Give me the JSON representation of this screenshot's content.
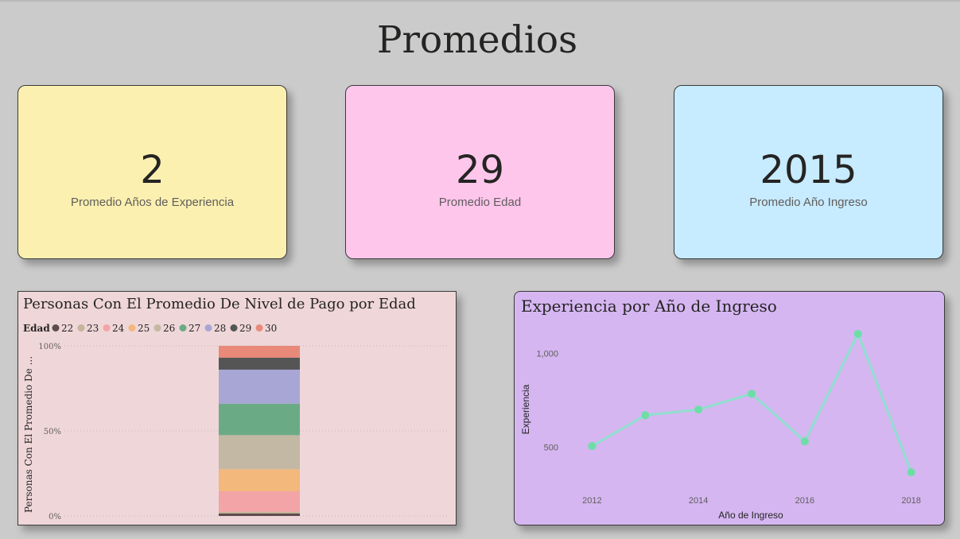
{
  "page": {
    "title": "Promedios"
  },
  "cards": [
    {
      "value": "2",
      "label": "Promedio Años de Experiencia",
      "bg": "#fbf0b0"
    },
    {
      "value": "29",
      "label": "Promedio Edad",
      "bg": "#ffc6ec"
    },
    {
      "value": "2015",
      "label": "Promedio Año Ingreso",
      "bg": "#c7ebff"
    }
  ],
  "chart_data": [
    {
      "type": "bar",
      "stacked": "100%",
      "title": "Personas Con El Promedio De Nivel de Pago por Edad",
      "ylabel": "Personas Con El Promedio De ...",
      "legend": {
        "title": "Edad",
        "placement": "top-left",
        "items": [
          {
            "name": "22",
            "color": "#5e4b4b"
          },
          {
            "name": "23",
            "color": "#c7b39a"
          },
          {
            "name": "24",
            "color": "#f3a4a6"
          },
          {
            "name": "25",
            "color": "#f2b87c"
          },
          {
            "name": "26",
            "color": "#c2b8a4"
          },
          {
            "name": "27",
            "color": "#6aab86"
          },
          {
            "name": "28",
            "color": "#a8a6d4"
          },
          {
            "name": "29",
            "color": "#555555"
          },
          {
            "name": "30",
            "color": "#e8897a"
          }
        ]
      },
      "yticks": [
        "100%",
        "50%",
        "0%"
      ],
      "ylim": [
        0,
        100
      ],
      "series": [
        {
          "name": "22",
          "value": 1.5
        },
        {
          "name": "23",
          "value": 1
        },
        {
          "name": "24",
          "value": 12
        },
        {
          "name": "25",
          "value": 13
        },
        {
          "name": "26",
          "value": 20
        },
        {
          "name": "27",
          "value": 18.5
        },
        {
          "name": "28",
          "value": 20
        },
        {
          "name": "29",
          "value": 7
        },
        {
          "name": "30",
          "value": 7
        }
      ],
      "background": "#efd6d9",
      "grid": true
    },
    {
      "type": "line",
      "title": "Experiencia por Año de Ingreso",
      "xlabel": "Año de Ingreso",
      "ylabel": "Experiencia",
      "x": [
        2012,
        2013,
        2014,
        2015,
        2016,
        2017,
        2018
      ],
      "values": [
        505,
        670,
        700,
        785,
        530,
        1105,
        365
      ],
      "xticks": [
        "2012",
        "2014",
        "2016",
        "2018"
      ],
      "yticks": [
        {
          "label": "1,000",
          "value": 1000
        },
        {
          "label": "500",
          "value": 500
        }
      ],
      "ylim": [
        310,
        1160
      ],
      "xlim": [
        2011.65,
        2018.35
      ],
      "line_color": "#8fdfce",
      "point_color": "#6cdea6",
      "background": "#d5b6f1",
      "grid": false
    }
  ]
}
